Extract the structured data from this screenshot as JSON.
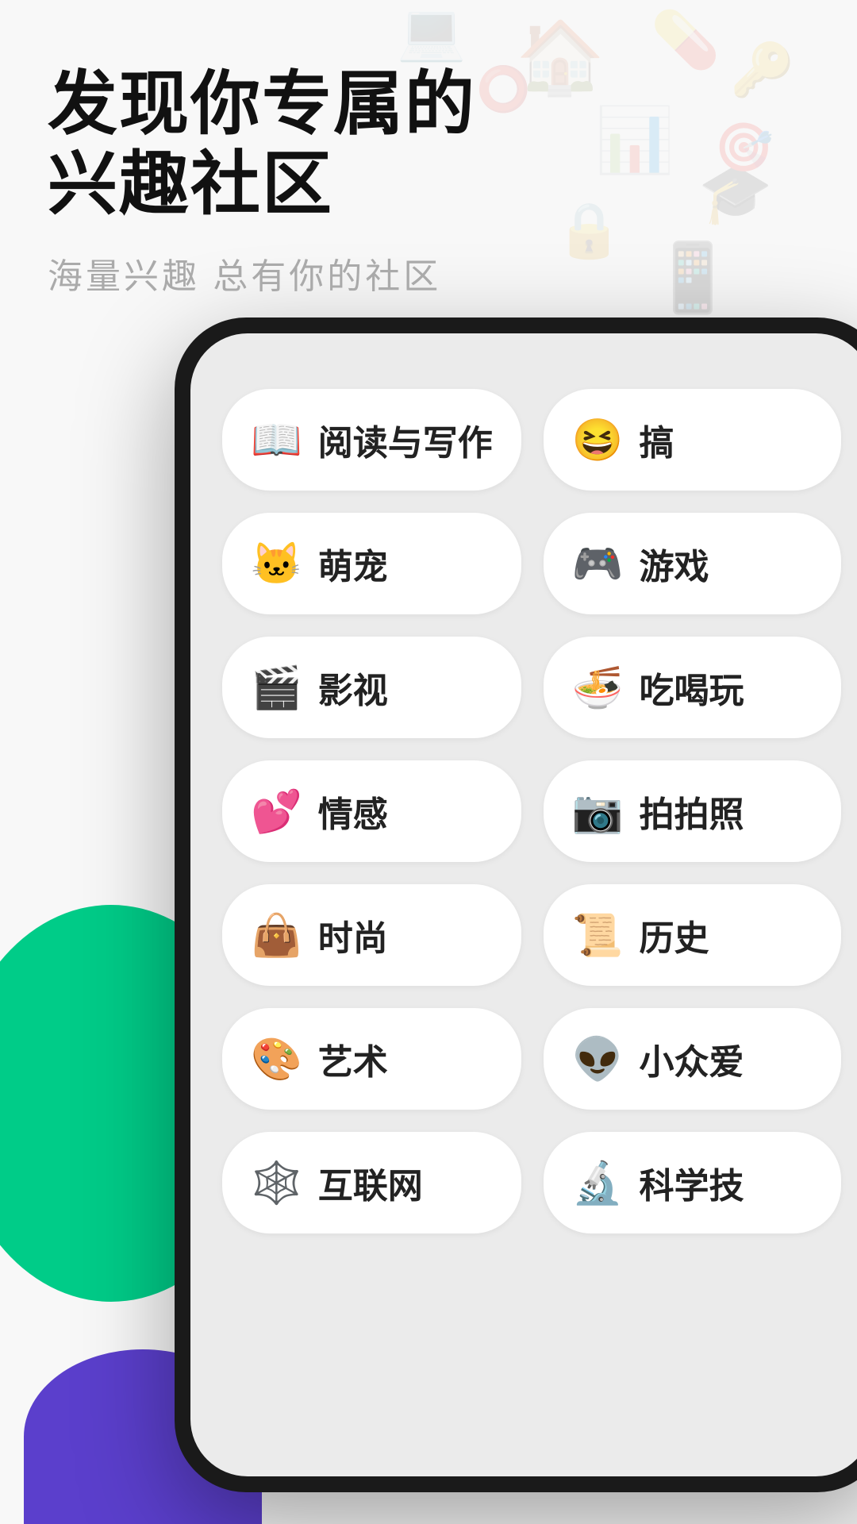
{
  "background": {
    "color": "#f5f5f5"
  },
  "header": {
    "main_title_line1": "发现你专属的",
    "main_title_line2": "兴趣社区",
    "sub_title": "海量兴趣  总有你的社区"
  },
  "categories": [
    {
      "id": "reading",
      "emoji": "📖",
      "label": "阅读与写作"
    },
    {
      "id": "funny",
      "emoji": "😆",
      "label": "搞笑"
    },
    {
      "id": "pets",
      "emoji": "🐱",
      "label": "萌宠"
    },
    {
      "id": "games",
      "emoji": "🎮",
      "label": "游戏"
    },
    {
      "id": "movies",
      "emoji": "🎬",
      "label": "影视"
    },
    {
      "id": "food",
      "emoji": "🍜",
      "label": "吃喝玩乐"
    },
    {
      "id": "emotion",
      "emoji": "💕",
      "label": "情感"
    },
    {
      "id": "photo",
      "emoji": "📷",
      "label": "拍拍照"
    },
    {
      "id": "fashion",
      "emoji": "👜",
      "label": "时尚"
    },
    {
      "id": "history",
      "emoji": "📜",
      "label": "历史"
    },
    {
      "id": "art",
      "emoji": "🎨",
      "label": "艺术"
    },
    {
      "id": "niche",
      "emoji": "👽",
      "label": "小众爱好"
    },
    {
      "id": "internet",
      "emoji": "🕸️",
      "label": "互联网"
    },
    {
      "id": "science",
      "emoji": "🔬",
      "label": "科学技术"
    }
  ],
  "decorative": {
    "green_color": "#00cc88",
    "purple_color": "#5533dd"
  }
}
